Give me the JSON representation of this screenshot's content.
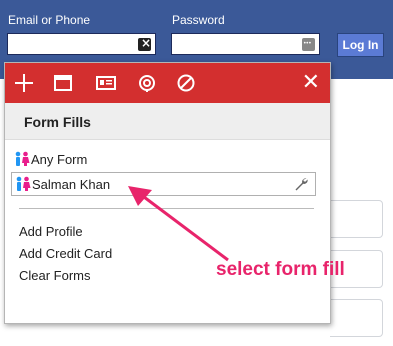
{
  "login_bar": {
    "email_label": "Email or Phone",
    "password_label": "Password",
    "email_value": "",
    "password_value": "",
    "login_button": "Log In"
  },
  "popup": {
    "toolbar": {
      "icons": [
        "plus-icon",
        "window-icon",
        "id-card-icon",
        "fingerprint-icon",
        "block-icon"
      ],
      "close_icon": "close-icon",
      "color": "#d32f2f"
    },
    "section_title": "Form Fills",
    "form_fills": [
      {
        "label": "Any Form",
        "selected": false
      },
      {
        "label": "Salman Khan",
        "selected": true
      }
    ],
    "actions": [
      "Add Profile",
      "Add Credit Card",
      "Clear Forms"
    ]
  },
  "annotation": {
    "text": "select form fill",
    "color": "#e8246b"
  }
}
